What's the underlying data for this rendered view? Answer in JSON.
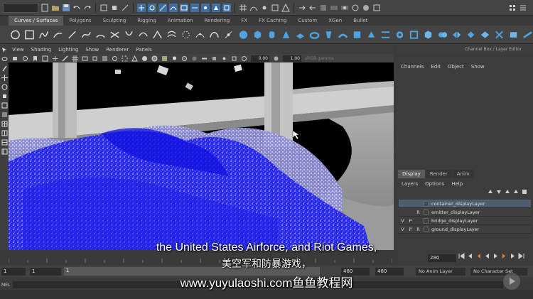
{
  "status_bar": {
    "mode_value": ""
  },
  "shelf": {
    "tabs": [
      "Curves / Surfaces",
      "Polygons",
      "Sculpting",
      "Rigging",
      "Animation",
      "Rendering",
      "FX",
      "FX Caching",
      "Custom",
      "XGen",
      "Bullet"
    ],
    "active_tab": 0
  },
  "viewport": {
    "menus": [
      "View",
      "Shading",
      "Lighting",
      "Show",
      "Renderer",
      "Panels"
    ],
    "near_value": "0.00",
    "far_value": "1.00",
    "color_label": "sRGB gamma"
  },
  "channel_box": {
    "title": "Channel Box / Layer Editor",
    "menus": [
      "Channels",
      "Edit",
      "Object",
      "Show"
    ]
  },
  "layer_editor": {
    "tabs": [
      "Display",
      "Render",
      "Anim"
    ],
    "active_tab": 0,
    "menus": [
      "Layers",
      "Options",
      "Help"
    ],
    "layers": [
      {
        "v": "",
        "p": "",
        "r": "",
        "name": "container_displayLayer",
        "color": "#3a4a5c",
        "selected": true
      },
      {
        "v": "",
        "p": "",
        "r": "R",
        "name": "emitter_displayLayer",
        "color": "#3f3f3f",
        "selected": false
      },
      {
        "v": "V",
        "p": "P",
        "r": "",
        "name": "bridge_displayLayer",
        "color": "#3f3f3f",
        "selected": false
      },
      {
        "v": "V",
        "p": "P",
        "r": "R",
        "name": "ground_displayLayer",
        "color": "#3f3f3f",
        "selected": false
      }
    ]
  },
  "timeline": {
    "start_frame": "1",
    "playback_start": "1",
    "range_start_label": "1",
    "range_end_field": "480",
    "end_frame": "480",
    "current_frame": "280",
    "anim_layer": "No Anim Layer",
    "character_set": "No Character Set"
  },
  "command_line": {
    "label": "MEL"
  },
  "subtitles": {
    "english": "the United States Airforce, and Riot Games,",
    "chinese": "美空军和防暴游戏，",
    "url": "www.yuyulaoshi.com鱼鱼教程网"
  },
  "colors": {
    "water": "#1010e0",
    "selection": "#4f5d6e",
    "accent": "#3d6fa3"
  }
}
